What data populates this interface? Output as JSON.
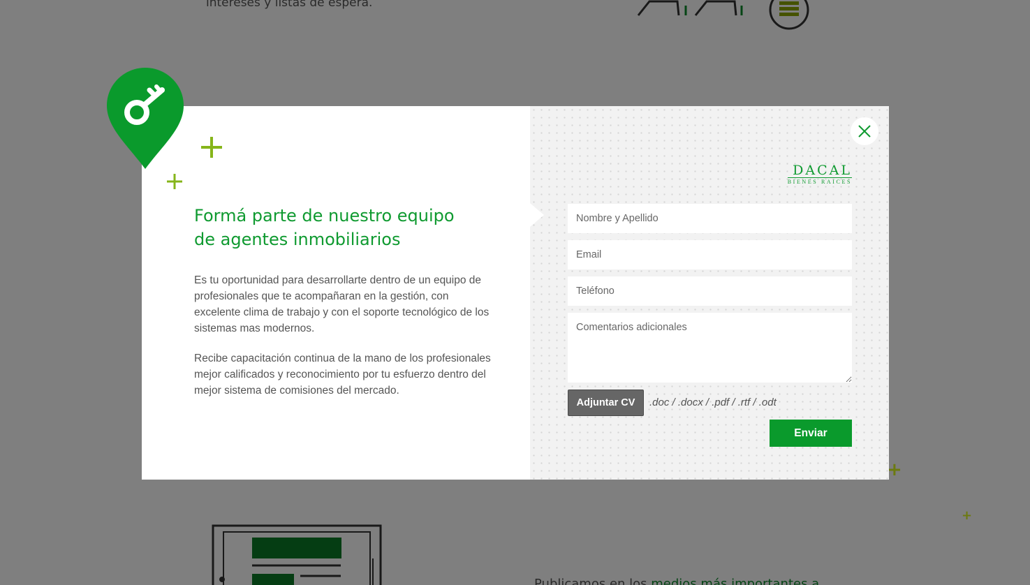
{
  "background": {
    "top_text": "intereses y listas de espera.",
    "bottom_text_prefix": "Publicamos en los ",
    "bottom_text_link": "medios más importantes a",
    "icons": [
      "home-outline-icon",
      "home-outline-icon",
      "stack-icon"
    ]
  },
  "modal": {
    "title_line1": "Formá parte de nuestro equipo",
    "title_line2": "de agentes inmobiliarios",
    "paragraph1": "Es tu oportunidad para desarrollarte dentro de un equipo de profesionales que te acompañaran en la gestión, con excelente clima de trabajo y con el soporte tecnológico de los sistemas mas modernos.",
    "paragraph2": "Recibe capacitación continua de la mano de los profesionales mejor calificados y reconocimiento por tu esfuerzo dentro del mejor sistema de comisiones del mercado.",
    "pin_icon": "location-key-icon",
    "close_icon": "close-icon"
  },
  "logo": {
    "main": "DACAL",
    "sub": "BIENES RAICES"
  },
  "form": {
    "name_placeholder": "Nombre y Apellido",
    "email_placeholder": "Email",
    "phone_placeholder": "Teléfono",
    "comments_placeholder": "Comentarios adicionales",
    "attach_label": "Adjuntar CV",
    "attach_formats": ".doc / .docx / .pdf / .rtf / .odt",
    "send_label": "Enviar"
  },
  "colors": {
    "brand_green": "#0f9a30",
    "accent_lime": "#86b51a",
    "attach_gray": "#666666"
  }
}
